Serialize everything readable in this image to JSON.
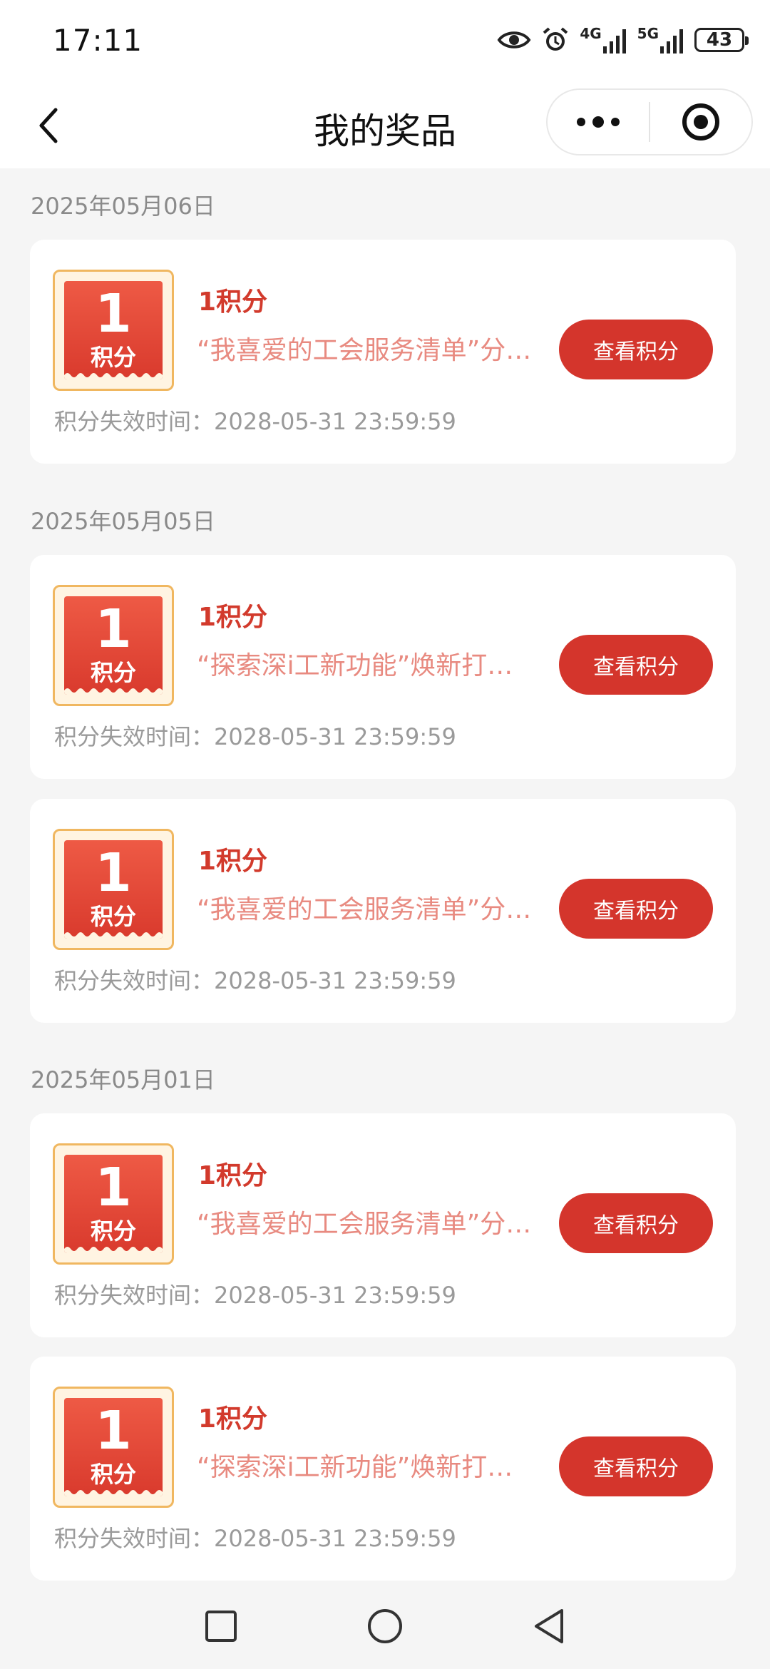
{
  "status_bar": {
    "time": "17:11",
    "network_4g": "4G",
    "network_5g": "5G",
    "battery": "43",
    "icons": [
      "eye-icon",
      "alarm-icon",
      "signal-4g-icon",
      "signal-5g-icon",
      "battery-icon"
    ]
  },
  "nav": {
    "title": "我的奖品",
    "back_icon": "chevron-left-icon",
    "more_icon": "more-dots-icon",
    "close_icon": "target-circle-icon"
  },
  "groups": [
    {
      "date": "2025年05月06日",
      "cards": [
        {
          "badge_num": "1",
          "badge_unit": "积分",
          "title": "1积分",
          "desc": "“我喜爱的工会服务清单”分…",
          "expiry": "积分失效时间：2028-05-31 23:59:59",
          "button": "查看积分"
        }
      ]
    },
    {
      "date": "2025年05月05日",
      "cards": [
        {
          "badge_num": "1",
          "badge_unit": "积分",
          "title": "1积分",
          "desc": "“探索深i工新功能”焕新打…",
          "expiry": "积分失效时间：2028-05-31 23:59:59",
          "button": "查看积分"
        },
        {
          "badge_num": "1",
          "badge_unit": "积分",
          "title": "1积分",
          "desc": "“我喜爱的工会服务清单”分…",
          "expiry": "积分失效时间：2028-05-31 23:59:59",
          "button": "查看积分"
        }
      ]
    },
    {
      "date": "2025年05月01日",
      "cards": [
        {
          "badge_num": "1",
          "badge_unit": "积分",
          "title": "1积分",
          "desc": "“我喜爱的工会服务清单”分…",
          "expiry": "积分失效时间：2028-05-31 23:59:59",
          "button": "查看积分"
        },
        {
          "badge_num": "1",
          "badge_unit": "积分",
          "title": "1积分",
          "desc": "“探索深i工新功能”焕新打…",
          "expiry": "积分失效时间：2028-05-31 23:59:59",
          "button": "查看积分"
        }
      ]
    }
  ],
  "system_nav": {
    "recents_icon": "square-recents-icon",
    "home_icon": "circle-home-icon",
    "back_icon": "triangle-back-icon"
  },
  "colors": {
    "accent": "#d4352c",
    "title": "#d23a2c",
    "desc": "#e88a80",
    "badge_border": "#f0b760",
    "background": "#f5f5f5"
  }
}
